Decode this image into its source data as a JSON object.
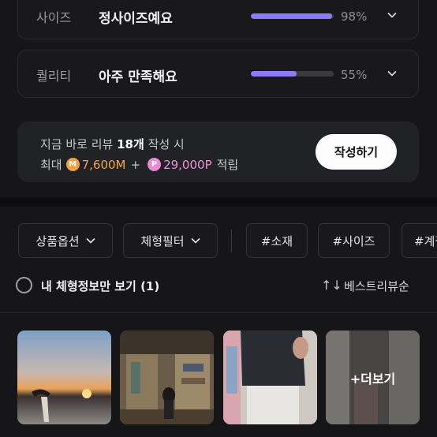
{
  "ratings": [
    {
      "label": "사이즈",
      "value": "정사이즈예요",
      "percent_text": "98%",
      "fill": 0.98
    },
    {
      "label": "퀄리티",
      "value": "아주 만족해요",
      "percent_text": "55%",
      "fill": 0.55
    }
  ],
  "promo": {
    "line1_prefix": "지금 바로 리뷰 ",
    "line1_count": "18개",
    "line1_suffix": " 작성 시",
    "max_label": "최대",
    "coin_m": "M",
    "amount_m": "7,600M",
    "plus": "+",
    "coin_p": "P",
    "amount_p": "29,000P",
    "earn_label": "적립",
    "write_button": "작성하기"
  },
  "filters": {
    "product_option": "상품옵션",
    "body_filter": "체형필터",
    "tags": [
      "#소재",
      "#사이즈",
      "#계절"
    ]
  },
  "options": {
    "only_mine_label": "내 체형정보만 보기 (1)",
    "sort_label": "베스트리뷰순",
    "sort_icon": "↑↓"
  },
  "gallery": {
    "more_label": "+더보기"
  },
  "colors": {
    "accent": "#8b7cf6",
    "mileage": "#f5a54a",
    "point": "#ef8fd8",
    "background": "#161618"
  }
}
